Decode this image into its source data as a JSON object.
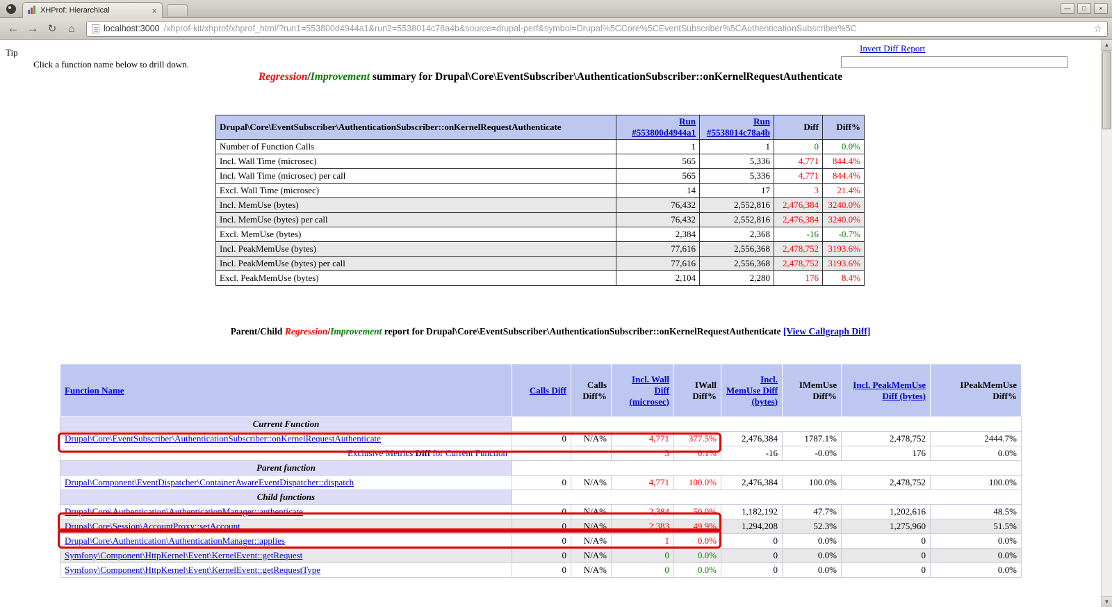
{
  "colors": {
    "regression": "#ff0000",
    "improvement": "#008000",
    "link": "#0000cc",
    "table_header_bg": "#bdc7f0",
    "section_row_bg": "#dcdcf8",
    "highlight_border": "#e40000"
  },
  "browser": {
    "tab": {
      "title": "XHProf: Hierarchical",
      "close": "×"
    },
    "window_controls": {
      "minimize": "—",
      "maximize": "□",
      "close": "×"
    },
    "nav": {
      "back": "←",
      "forward": "→",
      "reload": "↻",
      "home": "⌂"
    },
    "urlbar": {
      "host": "localhost:3000",
      "path": "/xhprof-kit/xhprof/xhprof_html/?run1=553800d4944a1&run2=5538014c78a4b&source=drupal-perf&symbol=Drupal%5CCore%5CEventSubscriber%5CAuthenticationSubscriber%5C",
      "star": "☆"
    },
    "scrollbar": {
      "up": "▲",
      "down": "▼"
    }
  },
  "page": {
    "tip_label": "Tip",
    "tip_text": "Click a function name below to drill down.",
    "invert_link": "Invert Diff Report",
    "title": {
      "regression": "Regression",
      "sep": "/",
      "improvement": "Improvement",
      "rest": " summary for Drupal\\Core\\EventSubscriber\\AuthenticationSubscriber::onKernelRequestAuthenticate"
    },
    "pc_heading": {
      "prefix": "Parent/Child ",
      "regression": "Regression",
      "sep": "/",
      "improvement": "Improvement",
      "rest": " report for Drupal\\Core\\EventSubscriber\\AuthenticationSubscriber::onKernelRequestAuthenticate ",
      "callgraph_link": "[View Callgraph Diff]"
    }
  },
  "summary": {
    "headers": {
      "symbol": "Drupal\\Core\\EventSubscriber\\AuthenticationSubscriber::onKernelRequestAuthenticate",
      "run1": "Run #553800d4944a1",
      "run2": "Run #5538014c78a4b",
      "diff": "Diff",
      "diff_pct": "Diff%"
    },
    "rows": [
      {
        "metric": "Number of Function Calls",
        "run1": "1",
        "run2": "1",
        "diff": "0",
        "diff_pct": "0.0%"
      },
      {
        "metric": "Incl. Wall Time (microsec)",
        "run1": "565",
        "run2": "5,336",
        "diff": "4,771",
        "diff_pct": "844.4%"
      },
      {
        "metric": "Incl. Wall Time (microsec) per call",
        "run1": "565",
        "run2": "5,336",
        "diff": "4,771",
        "diff_pct": "844.4%"
      },
      {
        "metric": "Excl. Wall Time (microsec)",
        "run1": "14",
        "run2": "17",
        "diff": "3",
        "diff_pct": "21.4%"
      },
      {
        "metric": "Incl. MemUse (bytes)",
        "run1": "76,432",
        "run2": "2,552,816",
        "diff": "2,476,384",
        "diff_pct": "3240.0%"
      },
      {
        "metric": "Incl. MemUse (bytes) per call",
        "run1": "76,432",
        "run2": "2,552,816",
        "diff": "2,476,384",
        "diff_pct": "3240.0%"
      },
      {
        "metric": "Excl. MemUse (bytes)",
        "run1": "2,384",
        "run2": "2,368",
        "diff": "-16",
        "diff_pct": "-0.7%"
      },
      {
        "metric": "Incl. PeakMemUse (bytes)",
        "run1": "77,616",
        "run2": "2,556,368",
        "diff": "2,478,752",
        "diff_pct": "3193.6%"
      },
      {
        "metric": "Incl. PeakMemUse (bytes) per call",
        "run1": "77,616",
        "run2": "2,556,368",
        "diff": "2,478,752",
        "diff_pct": "3193.6%"
      },
      {
        "metric": "Excl. PeakMemUse (bytes)",
        "run1": "2,104",
        "run2": "2,280",
        "diff": "176",
        "diff_pct": "8.4%"
      }
    ]
  },
  "pc": {
    "headers": {
      "fn": "Function Name",
      "calls": "Calls Diff",
      "calls_pct": "Calls Diff%",
      "wall": "Incl. Wall Diff (microsec)",
      "wall_pct": "IWall Diff%",
      "mem": "Incl. MemUse Diff (bytes)",
      "mem_pct": "IMemUse Diff%",
      "peak": "Incl. PeakMemUse Diff (bytes)",
      "peak_pct": "IPeakMemUse Diff%"
    },
    "sections": {
      "current": "Current Function",
      "parent": "Parent function",
      "children": "Child functions"
    },
    "exclusive": {
      "pre": "Exclusive Metrics ",
      "bold": "Diff",
      "post": " for Current Function",
      "wall": "3",
      "wall_pct": "0.1%",
      "mem": "-16",
      "mem_pct": "-0.0%",
      "peak": "176",
      "peak_pct": "0.0%"
    },
    "rows": [
      {
        "name": "Drupal\\Core\\EventSubscriber\\AuthenticationSubscriber::onKernelRequestAuthenticate",
        "calls": "0",
        "calls_pct": "N/A%",
        "wall": "4,771",
        "wall_pct": "377.5%",
        "mem": "2,476,384",
        "mem_pct": "1787.1%",
        "peak": "2,478,752",
        "peak_pct": "2444.7%"
      },
      {
        "name": "Drupal\\Component\\EventDispatcher\\ContainerAwareEventDispatcher::dispatch",
        "calls": "0",
        "calls_pct": "N/A%",
        "wall": "4,771",
        "wall_pct": "100.0%",
        "mem": "2,476,384",
        "mem_pct": "100.0%",
        "peak": "2,478,752",
        "peak_pct": "100.0%"
      },
      {
        "name": "Drupal\\Core\\Authentication\\AuthenticationManager::authenticate",
        "calls": "0",
        "calls_pct": "N/A%",
        "wall": "2,384",
        "wall_pct": "50.0%",
        "mem": "1,182,192",
        "mem_pct": "47.7%",
        "peak": "1,202,616",
        "peak_pct": "48.5%"
      },
      {
        "name": "Drupal\\Core\\Session\\AccountProxy::setAccount",
        "calls": "0",
        "calls_pct": "N/A%",
        "wall": "2,383",
        "wall_pct": "49.9%",
        "mem": "1,294,208",
        "mem_pct": "52.3%",
        "peak": "1,275,960",
        "peak_pct": "51.5%"
      },
      {
        "name": "Drupal\\Core\\Authentication\\AuthenticationManager::applies",
        "calls": "0",
        "calls_pct": "N/A%",
        "wall": "1",
        "wall_pct": "0.0%",
        "mem": "0",
        "mem_pct": "0.0%",
        "peak": "0",
        "peak_pct": "0.0%"
      },
      {
        "name": "Symfony\\Component\\HttpKernel\\Event\\KernelEvent::getRequest",
        "calls": "0",
        "calls_pct": "N/A%",
        "wall": "0",
        "wall_pct": "0.0%",
        "mem": "0",
        "mem_pct": "0.0%",
        "peak": "0",
        "peak_pct": "0.0%"
      },
      {
        "name": "Symfony\\Component\\HttpKernel\\Event\\KernelEvent::getRequestType",
        "calls": "0",
        "calls_pct": "N/A%",
        "wall": "0",
        "wall_pct": "0.0%",
        "mem": "0",
        "mem_pct": "0.0%",
        "peak": "0",
        "peak_pct": "0.0%"
      }
    ]
  }
}
